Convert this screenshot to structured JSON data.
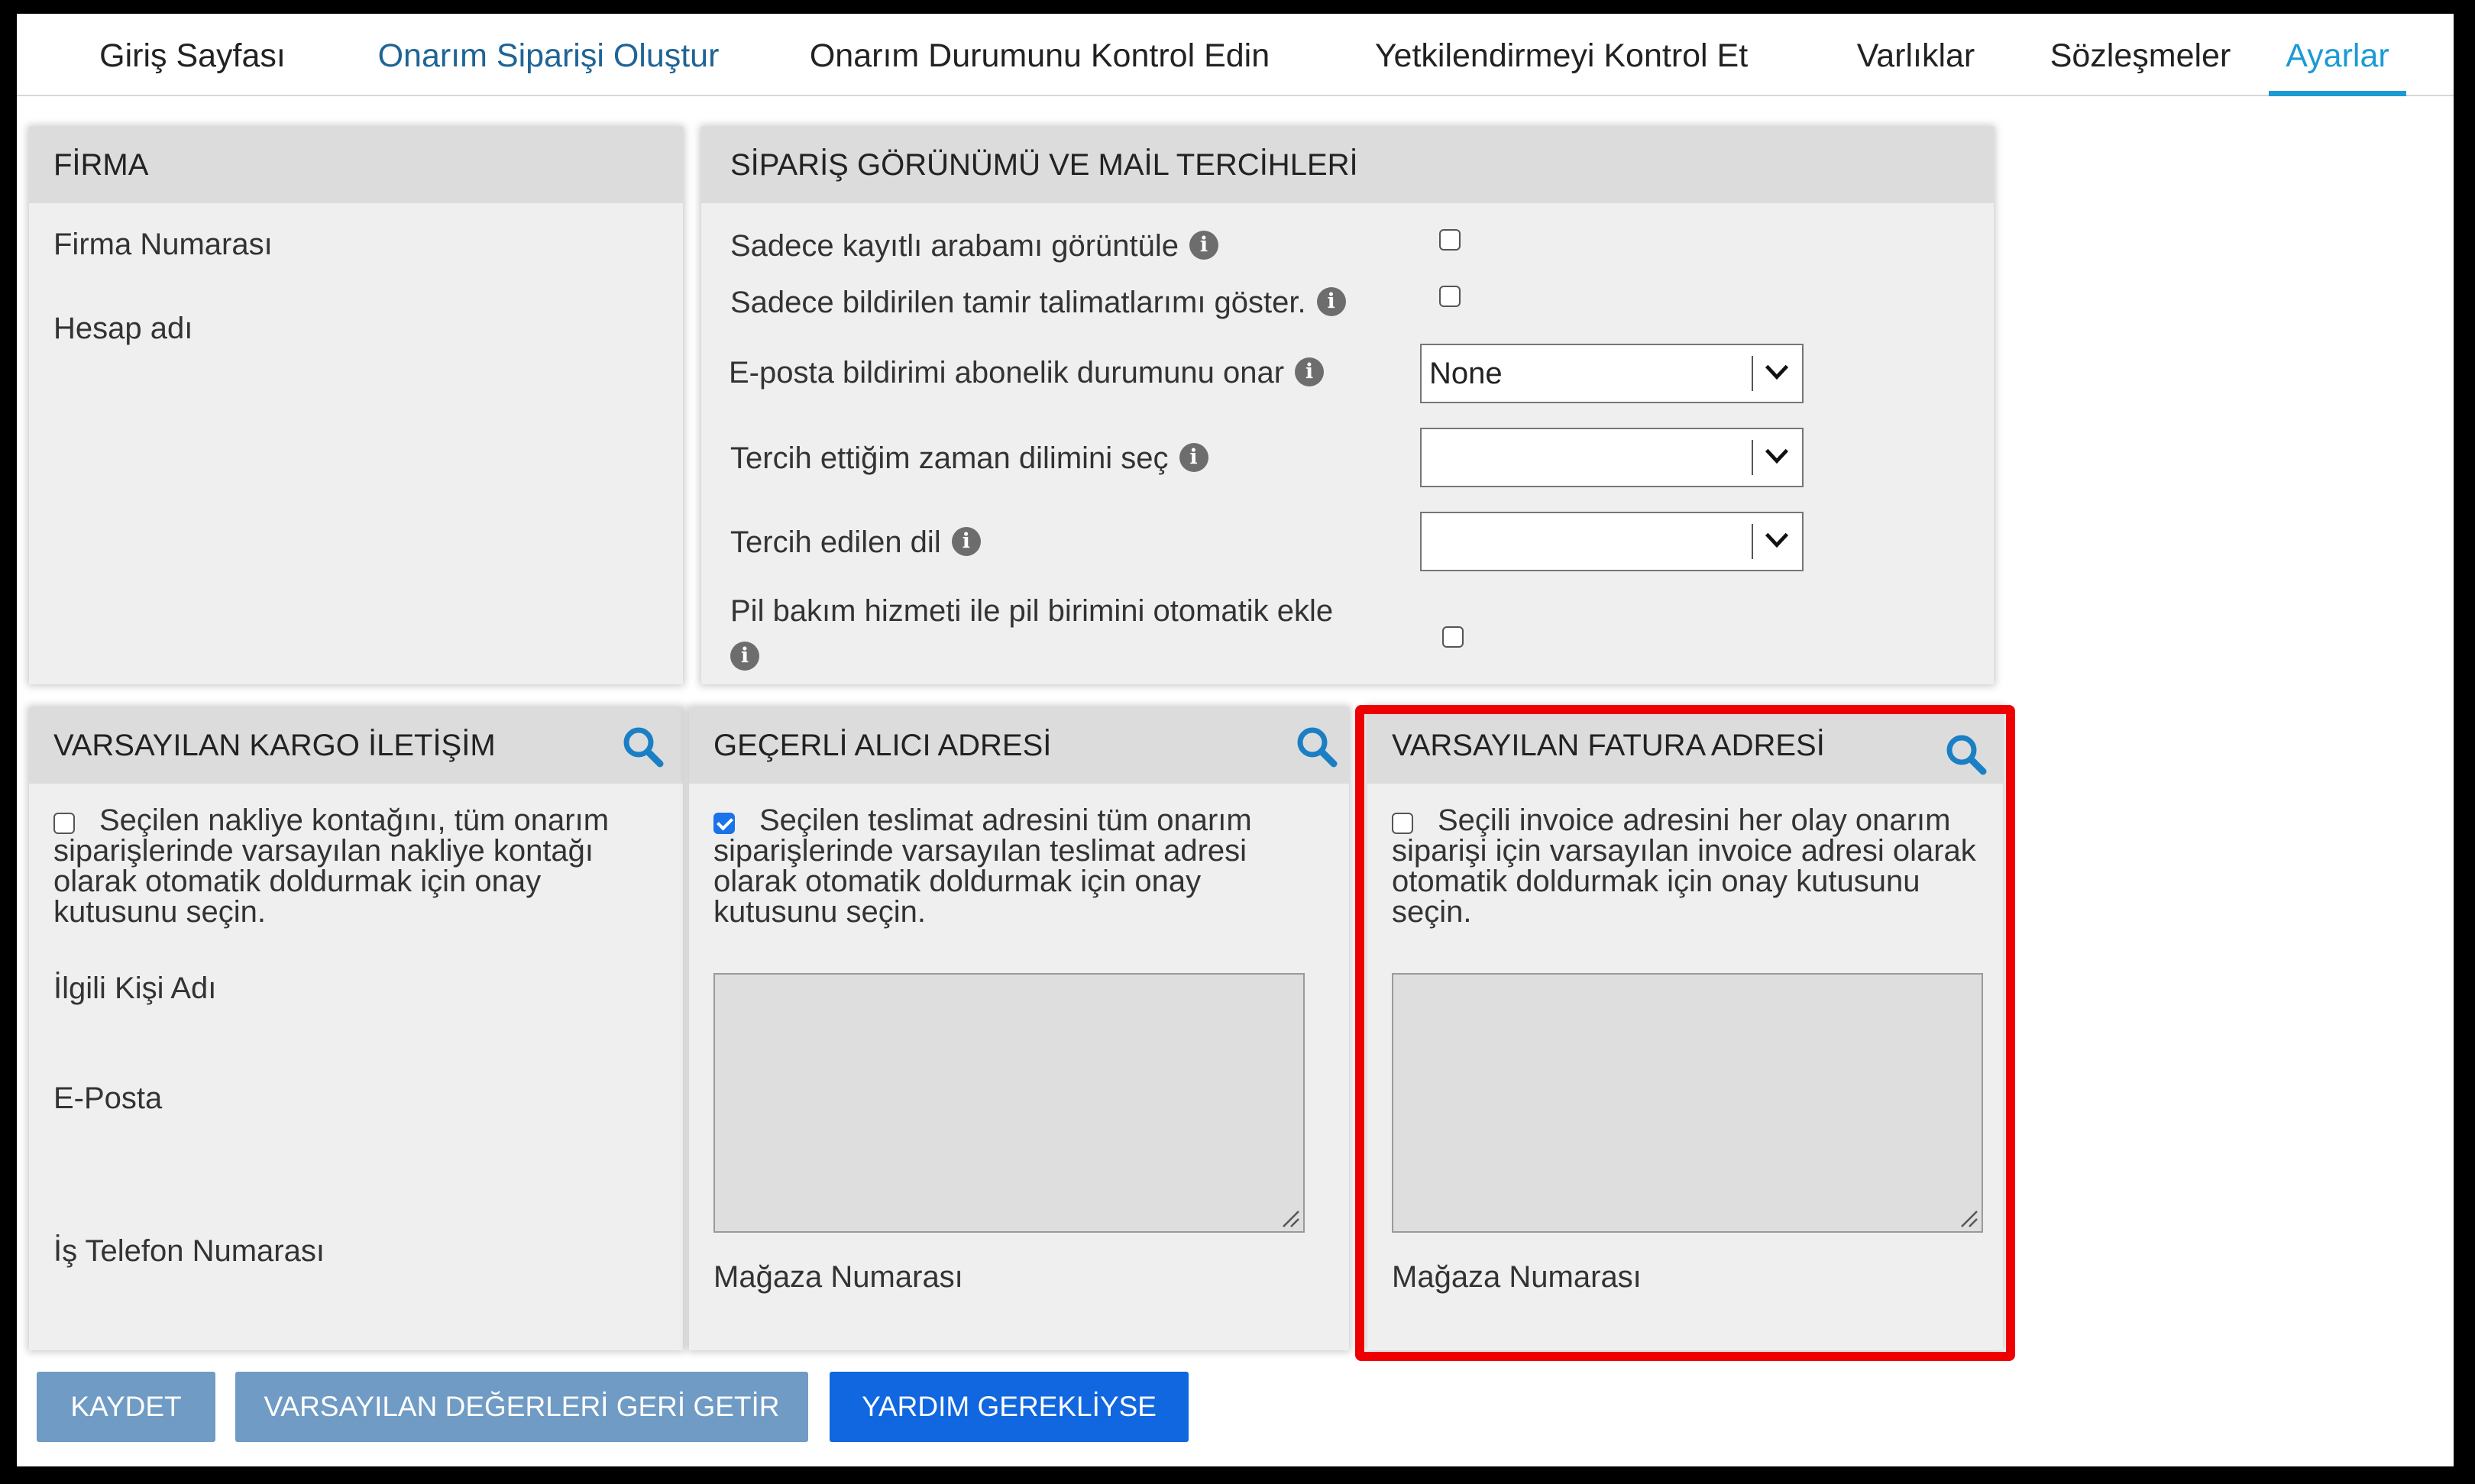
{
  "nav": {
    "tabs": [
      {
        "label": "Giriş Sayfası"
      },
      {
        "label": "Onarım Siparişi Oluştur"
      },
      {
        "label": "Onarım Durumunu Kontrol Edin"
      },
      {
        "label": "Yetkilendirmeyi Kontrol Et"
      },
      {
        "label": "Varlıklar"
      },
      {
        "label": "Sözleşmeler"
      },
      {
        "label": "Ayarlar"
      }
    ],
    "active_tab": "Ayarlar"
  },
  "firma": {
    "title": "FİRMA",
    "firma_numarasi_label": "Firma Numarası",
    "hesap_adi_label": "Hesap adı"
  },
  "siparis": {
    "title": "SİPARİŞ GÖRÜNÜMÜ VE MAİL TERCİHLERİ",
    "rows": [
      {
        "label": "Sadece kayıtlı arabamı görüntüle",
        "checked": false
      },
      {
        "label": "Sadece bildirilen tamir talimatlarımı göster.",
        "checked": false
      },
      {
        "label": "E-posta bildirimi abonelik durumunu onar",
        "value": "None"
      },
      {
        "label": "Tercih ettiğim zaman dilimini seç",
        "value": ""
      },
      {
        "label": "Tercih edilen dil",
        "value": ""
      },
      {
        "label": "Pil bakım hizmeti ile pil birimini otomatik ekle",
        "checked": false
      }
    ]
  },
  "kargo": {
    "title": "VARSAYILAN KARGO İLETİŞİM",
    "checked": false,
    "description": "Seçilen nakliye kontağını, tüm onarım siparişlerinde varsayılan nakliye kontağı olarak otomatik doldurmak için onay kutusunu seçin.",
    "ilgili_kisi_label": "İlgili Kişi Adı",
    "eposta_label": "E-Posta",
    "telefon_label": "İş Telefon Numarası"
  },
  "alici": {
    "title": "GEÇERLİ ALICI ADRESİ",
    "checked": true,
    "description": "Seçilen teslimat adresini tüm onarım siparişlerinde varsayılan teslimat adresi olarak otomatik doldurmak için onay kutusunu seçin.",
    "magaza_label": "Mağaza Numarası"
  },
  "fatura": {
    "title": "VARSAYILAN FATURA ADRESİ",
    "checked": false,
    "description": "Seçili invoice adresini her olay onarım siparişi için varsayılan invoice adresi olarak otomatik doldurmak için onay kutusunu seçin.",
    "magaza_label": "Mağaza Numarası"
  },
  "buttons": {
    "save": "KAYDET",
    "restore_defaults": "VARSAYILAN DEĞERLERİ GERİ GETİR",
    "help": "YARDIM GEREKLİYSE"
  },
  "colors": {
    "accent": "#1c9ad6",
    "link": "#1f6496",
    "highlight": "#ee0000",
    "primary_button": "#1067df",
    "secondary_button": "#6f9bc4"
  },
  "icons": [
    "info-icon",
    "search-icon",
    "chevron-down-icon",
    "resize-handle-icon"
  ]
}
